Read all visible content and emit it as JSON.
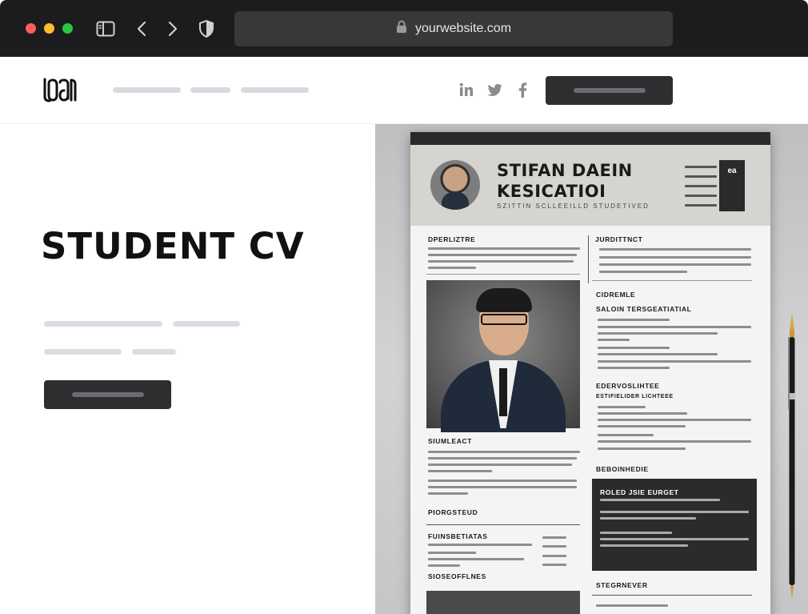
{
  "browser": {
    "url": "yourwebsite.com"
  },
  "header": {
    "social": [
      "linkedin-icon",
      "twitter-icon",
      "facebook-icon"
    ]
  },
  "hero": {
    "title": "STUDENT CV"
  },
  "cv": {
    "name_line1": "STIFAN DAEIN",
    "name_line2": "KESICATIOI",
    "subtitle": "SZITTIN SCLLEEILLD STUDETIVED",
    "contact_badge": "ea",
    "sections": {
      "s1": "DPERLIZTRE",
      "s2": "JURDITTNCT",
      "s3": "CIDREMLE",
      "s3b": "SALOIN TERSGEATIATIAL",
      "s4": "EDERVOSLIHTEE",
      "s4b": "ESTIFIELIDER LICHTEEE",
      "s5": "BEBOINHEDIE",
      "dark_title": "ROLED JSIE EURGET",
      "s6": "SIUMLEACT",
      "s7": "PIORGSTEUD",
      "s8": "FUINSBETIATAS",
      "s9": "SIOSEOFFLNES",
      "s10": "STEGRNEVER"
    }
  }
}
